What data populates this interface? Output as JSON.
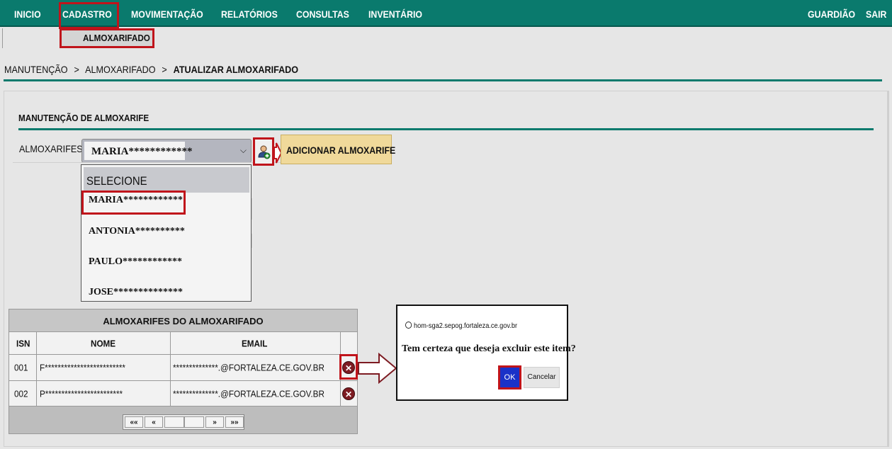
{
  "nav": {
    "items": [
      "INICIO",
      "CADASTRO",
      "MOVIMENTAÇÃO",
      "RELATÓRIOS",
      "CONSULTAS",
      "INVENTÁRIO"
    ],
    "right": [
      "GUARDIÃO",
      "SAIR"
    ],
    "submenu": "ALMOXARIFADO"
  },
  "breadcrumb": {
    "items": [
      "MANUTENÇÃO",
      "ALMOXARIFADO"
    ],
    "separator": ">",
    "current": "ATUALIZAR ALMOXARIFADO"
  },
  "section": {
    "title": "MANUTENÇÃO DE ALMOXARIFE",
    "field_label": "ALMOXARIFES:",
    "selected_value": "MARIA************",
    "options": [
      "SELECIONE",
      "MARIA************",
      "ANTONIA**********",
      "PAULO************",
      "JOSE**************"
    ],
    "add_button": "ADICIONAR ALMOXARIFE"
  },
  "table": {
    "title": "ALMOXARIFES DO ALMOXARIFADO",
    "headers": [
      "ISN",
      "NOME",
      "EMAIL"
    ],
    "rows": [
      {
        "isn": "001",
        "nome": "F*************************",
        "email": "**************.@FORTALEZA.CE.GOV.BR"
      },
      {
        "isn": "002",
        "nome": "P************************",
        "email": "**************.@FORTALEZA.CE.GOV.BR"
      }
    ],
    "pager": [
      "««",
      "«",
      "",
      "",
      "»",
      "»»"
    ]
  },
  "dialog": {
    "host": "hom-sga2.sepog.fortaleza.ce.gov.br",
    "message": "Tem certeza que deseja excluir este item?",
    "ok": "OK",
    "cancel": "Cancelar"
  },
  "colors": {
    "nav_bg": "#0a7a6d",
    "highlight": "#c0141b",
    "ok_button": "#1a32c8",
    "add_button": "#f0d99a",
    "delete_icon": "#7d1b22"
  }
}
